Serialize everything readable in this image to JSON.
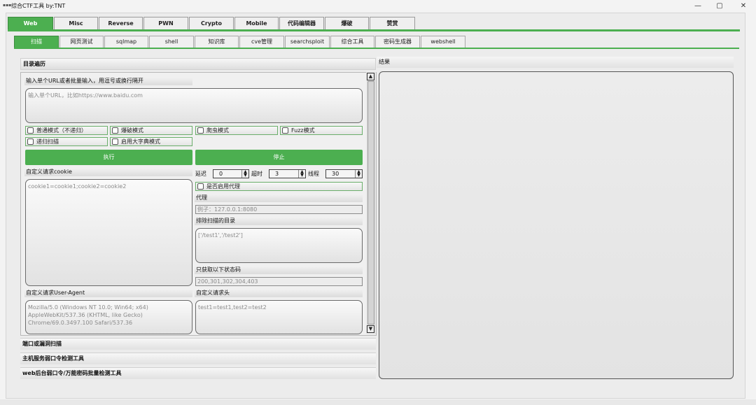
{
  "window": {
    "title": "综合CTF工具   by:TNT",
    "icon": "app-icon",
    "min": "—",
    "max": "▢",
    "close": "✕"
  },
  "main_tabs": [
    {
      "label": "Web",
      "active": true
    },
    {
      "label": "Misc"
    },
    {
      "label": "Reverse"
    },
    {
      "label": "PWN"
    },
    {
      "label": "Crypto"
    },
    {
      "label": "Mobile"
    },
    {
      "label": "代码编辑器"
    },
    {
      "label": "爆破"
    },
    {
      "label": "赞赏"
    }
  ],
  "sub_tabs": [
    {
      "label": "扫描",
      "active": true
    },
    {
      "label": "网页测试"
    },
    {
      "label": "sqlmap"
    },
    {
      "label": "shell"
    },
    {
      "label": "知识库"
    },
    {
      "label": "cve管理"
    },
    {
      "label": "searchsploit"
    },
    {
      "label": "综合工具"
    },
    {
      "label": "密码生成器"
    },
    {
      "label": "webshell"
    }
  ],
  "dir_scan": {
    "header": "目录遍历",
    "url_label": "输入单个URL或者批量输入，用逗号或换行隔开",
    "url_placeholder": "输入单个URL，比如https://www.baidu.com",
    "checkboxes": [
      "普通模式（不递归）",
      "爆破模式",
      "爬虫模式",
      "Fuzz模式",
      "递归扫描",
      "启用大字典模式"
    ],
    "execute": "执行",
    "stop": "停止",
    "cookie_label": "自定义请求cookie",
    "cookie_placeholder": "cookie1=cookie1;cookie2=cookie2",
    "delay_label": "延迟",
    "delay_value": "0",
    "timeout_label": "超时",
    "timeout_value": "3",
    "threads_label": "线程",
    "threads_value": "30",
    "proxy_check": "是否启用代理",
    "proxy_label": "代理",
    "proxy_placeholder": "例子：127.0.0.1:8080",
    "exclude_label": "排除扫描的目录",
    "exclude_placeholder": "['/test1','/test2']",
    "status_label": "只获取以下状态码",
    "status_placeholder": "200,301,302,304,403",
    "ua_label": "自定义请求User-Agent",
    "ua_placeholder": "Mozilla/5.0 (Windows NT 10.0; Win64; x64) AppleWebKit/537.36 (KHTML, like Gecko) Chrome/69.0.3497.100 Safari/537.36",
    "headers_label": "自定义请求头",
    "headers_placeholder": "test1=test1,test2=test2"
  },
  "collapsed_sections": [
    "端口或漏洞扫描",
    "主机服务弱口令检测工具",
    "web后台弱口令/万能密码批量检测工具"
  ],
  "result": {
    "header": "结果"
  },
  "colors": {
    "accent": "#4caf50"
  }
}
